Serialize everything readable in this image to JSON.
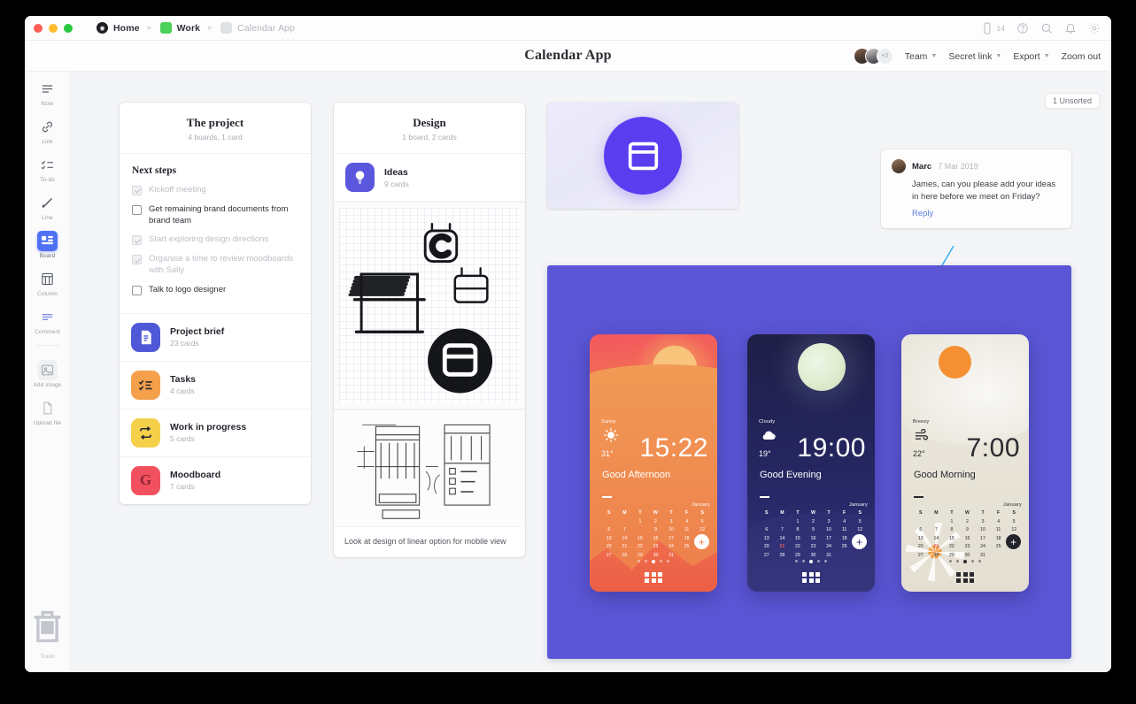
{
  "window": {
    "breadcrumbs": [
      {
        "label": "Home",
        "icon": "milanote-logo-icon",
        "muted": false
      },
      {
        "label": "Work",
        "icon": "green-square-icon",
        "muted": false
      },
      {
        "label": "Calendar App",
        "icon": "grey-square-icon",
        "muted": true
      }
    ],
    "titlebar_icons": [
      "device-icon",
      "help-icon",
      "search-icon",
      "bell-icon",
      "gear-icon"
    ],
    "device_count": "14"
  },
  "header": {
    "title": "Calendar App",
    "avatar_more": "+2",
    "actions": [
      {
        "label": "Team",
        "caret": true
      },
      {
        "label": "Secret link",
        "caret": true
      },
      {
        "label": "Export",
        "caret": true
      },
      {
        "label": "Zoom out",
        "caret": false
      }
    ]
  },
  "toolbar": {
    "items": [
      {
        "name": "note",
        "label": "Note",
        "icon": "note-icon",
        "active": false
      },
      {
        "name": "link",
        "label": "Link",
        "icon": "link-icon",
        "active": false
      },
      {
        "name": "todo",
        "label": "To-do",
        "icon": "todo-icon",
        "active": false
      },
      {
        "name": "line",
        "label": "Line",
        "icon": "line-icon",
        "active": false
      },
      {
        "name": "board",
        "label": "Board",
        "icon": "board-icon",
        "active": true
      },
      {
        "name": "column",
        "label": "Column",
        "icon": "column-icon",
        "active": false
      },
      {
        "name": "comment",
        "label": "Comment",
        "icon": "comment-icon",
        "active": false
      },
      {
        "name": "add-image",
        "label": "Add image",
        "icon": "image-icon",
        "active": false
      },
      {
        "name": "upload-file",
        "label": "Upload file",
        "icon": "file-icon",
        "active": false
      }
    ],
    "trash_label": "Trash"
  },
  "canvas": {
    "unsorted_badge": "1 Unsorted"
  },
  "board_project": {
    "title": "The project",
    "subtitle": "4 boards, 1 card",
    "todo_title": "Next steps",
    "todos": [
      {
        "text": "Kickoff meeting",
        "done": true
      },
      {
        "text": "Get remaining brand documents from brand team",
        "done": false
      },
      {
        "text": "Start exploring design directions",
        "done": true
      },
      {
        "text": "Organise a time to review moodboards with Sally",
        "done": true
      },
      {
        "text": "Talk to logo designer",
        "done": false
      }
    ],
    "boards": [
      {
        "name": "Project brief",
        "cards": "23 cards",
        "icon": "document-icon",
        "color": "#4f58d6"
      },
      {
        "name": "Tasks",
        "cards": "4 cards",
        "icon": "checklist-icon",
        "color": "#f5a04b"
      },
      {
        "name": "Work in progress",
        "cards": "5 cards",
        "icon": "refresh-icon",
        "color": "#f5d04b"
      },
      {
        "name": "Moodboard",
        "cards": "7 cards",
        "icon": "letter-g-icon",
        "color": "#f1515f"
      }
    ]
  },
  "board_design": {
    "title": "Design",
    "subtitle": "1 board, 2 cards",
    "boards": [
      {
        "name": "Ideas",
        "cards": "9 cards",
        "icon": "lightbulb-icon",
        "color": "#5b57dd"
      }
    ],
    "sketch_note": "Look at design of linear option for mobile view"
  },
  "comment": {
    "author": "Marc",
    "date": "7 Mar 2019",
    "body": "James, can you please add your ideas in here before we meet on Friday?",
    "reply_label": "Reply"
  },
  "mockups": {
    "background_color": "#5b56d6",
    "phones": [
      {
        "id": "phone-1",
        "weather": "Sunny",
        "weather_icon": "sun-icon",
        "temp": "31°",
        "time": "15:22",
        "greeting": "Good Afternoon",
        "month": "January",
        "theme": "light",
        "today": "8",
        "accent": "#ef7a48"
      },
      {
        "id": "phone-2",
        "weather": "Cloudy",
        "weather_icon": "cloud-icon",
        "temp": "19°",
        "time": "19:00",
        "greeting": "Good Evening",
        "month": "January",
        "theme": "light",
        "today": "21",
        "accent": "#e8635e"
      },
      {
        "id": "phone-3",
        "weather": "Breezy",
        "weather_icon": "wind-icon",
        "temp": "22°",
        "time": "7:00",
        "greeting": "Good Morning",
        "month": "January",
        "theme": "dark",
        "today": "21",
        "accent": "#e8635e"
      }
    ],
    "calendar": {
      "dow": [
        "S",
        "M",
        "T",
        "W",
        "T",
        "F",
        "S"
      ],
      "leading_blanks": 2,
      "days": [
        1,
        2,
        3,
        4,
        5,
        6,
        7,
        8,
        9,
        10,
        11,
        12,
        13,
        14,
        15,
        16,
        17,
        18,
        19,
        20,
        21,
        22,
        23,
        24,
        25,
        26,
        27,
        28,
        29,
        30,
        31
      ]
    }
  }
}
